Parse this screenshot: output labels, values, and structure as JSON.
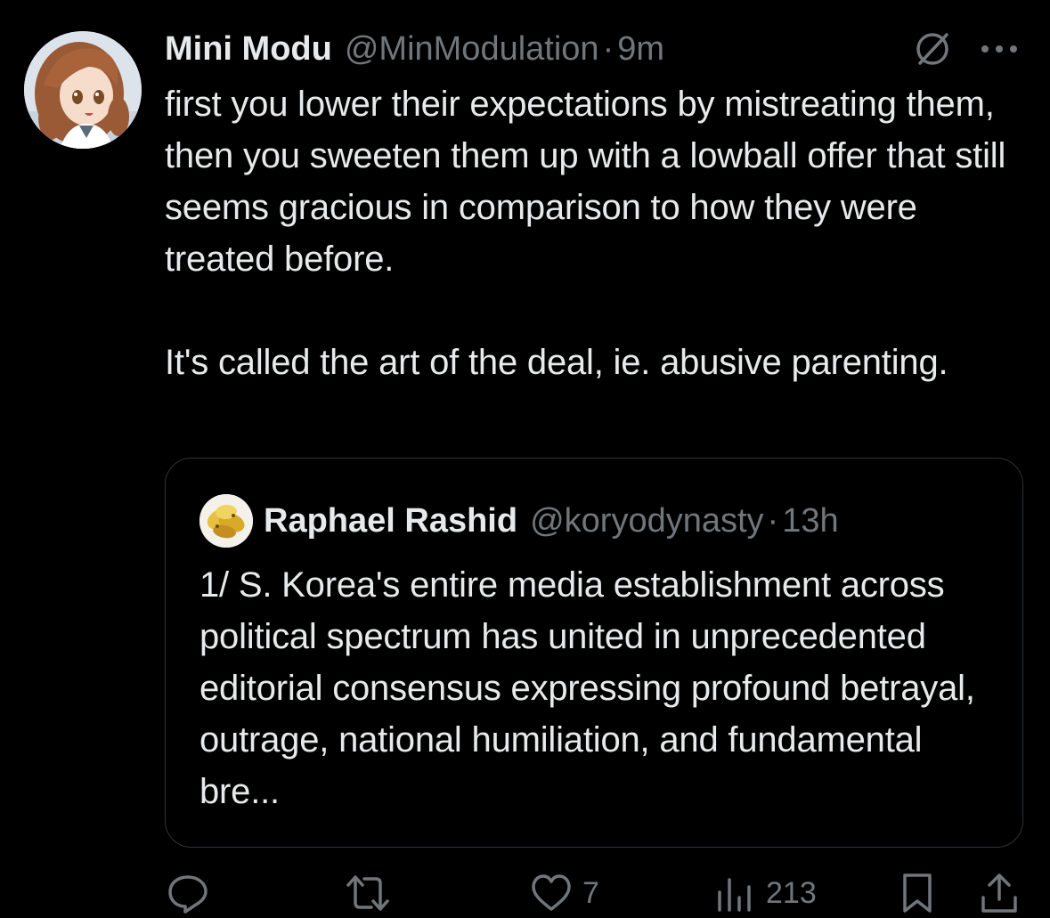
{
  "tweet": {
    "author": {
      "display_name": "Mini Modu",
      "handle": "@MinModulation",
      "avatar_icon": "anime-avatar"
    },
    "separator": "·",
    "time": "9m",
    "text": "first you lower their expectations by mistreating them, then you sweeten them up with a lowball offer that still seems gracious in comparison to how they were treated before.\n\n It's called the art of the deal, ie. abusive parenting.",
    "header_icons": [
      "grok-icon",
      "more-icon"
    ]
  },
  "quote": {
    "author": {
      "display_name": "Raphael Rashid",
      "handle": "@koryodynasty",
      "avatar_icon": "chips-avatar"
    },
    "separator": "·",
    "time": "13h",
    "text": "1/ S. Korea's entire media establishment across political spectrum has united in unprecedented editorial consensus expressing profound betrayal, outrage, national humiliation, and fundamental bre..."
  },
  "actions": {
    "reply": {
      "icon": "reply-icon",
      "count": ""
    },
    "repost": {
      "icon": "repost-icon",
      "count": ""
    },
    "like": {
      "icon": "heart-icon",
      "count": "7"
    },
    "views": {
      "icon": "views-icon",
      "count": "213"
    },
    "bookmark": {
      "icon": "bookmark-icon"
    },
    "share": {
      "icon": "share-icon"
    }
  },
  "colors": {
    "background": "#000000",
    "primary_text": "#e7e9ea",
    "secondary_text": "#71767b",
    "border": "#2f3336"
  }
}
